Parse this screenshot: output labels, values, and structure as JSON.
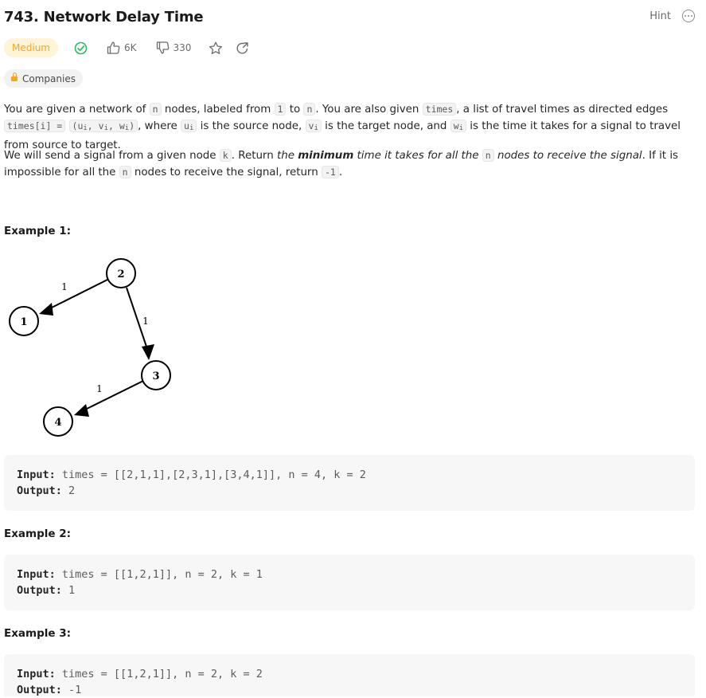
{
  "problem": {
    "title": "743. Network Delay Time",
    "hint_label": "Hint",
    "difficulty": "Medium",
    "likes": "6K",
    "dislikes": "330",
    "companies_label": "Companies"
  },
  "description": {
    "p1": {
      "t1": "You are given a network of ",
      "c_n": "n",
      "t2": " nodes, labeled from ",
      "c_1": "1",
      "t3": " to ",
      "c_n2": "n",
      "t4": ". You are also given ",
      "c_times": "times",
      "t5": ", a list of travel times as directed edges ",
      "c_timesi": "times[i] =",
      "c_tuple_open": "(u",
      "c_tuple_sep1": ", v",
      "c_tuple_sep2": ", w",
      "c_tuple_close": ")",
      "sub_i": "i",
      "t6": ", where ",
      "c_u": "u",
      "t7": " is the source node, ",
      "c_v": "v",
      "t8": " is the target node, and ",
      "c_w": "w",
      "t9": " is the time it takes for a signal to travel from source to target."
    },
    "p2": {
      "t1": "We will send a signal from a given node ",
      "c_k": "k",
      "t2": ". Return ",
      "em1": "the ",
      "strong": "minimum",
      "em2": " time it takes for all the ",
      "c_n": "n",
      "em3": " nodes to receive the signal",
      "t3": ". If it is impossible for all the ",
      "c_n2": "n",
      "t4": " nodes to receive the signal, return ",
      "c_neg": "-1",
      "t5": "."
    }
  },
  "graph": {
    "nodes": [
      "1",
      "2",
      "3",
      "4"
    ],
    "edge_weights": [
      "1",
      "1",
      "1"
    ]
  },
  "examples": [
    {
      "heading": "Example 1:",
      "input_label": "Input:",
      "input": " times = [[2,1,1],[2,3,1],[3,4,1]], n = 4, k = 2",
      "output_label": "Output:",
      "output": " 2"
    },
    {
      "heading": "Example 2:",
      "input_label": "Input:",
      "input": " times = [[1,2,1]], n = 2, k = 1",
      "output_label": "Output:",
      "output": " 1"
    },
    {
      "heading": "Example 3:",
      "input_label": "Input:",
      "input": " times = [[1,2,1]], n = 2, k = 2",
      "output_label": "Output:",
      "output": " -1"
    }
  ],
  "colors": {
    "medium": "#f5a623",
    "solved": "#2cbb5d"
  }
}
